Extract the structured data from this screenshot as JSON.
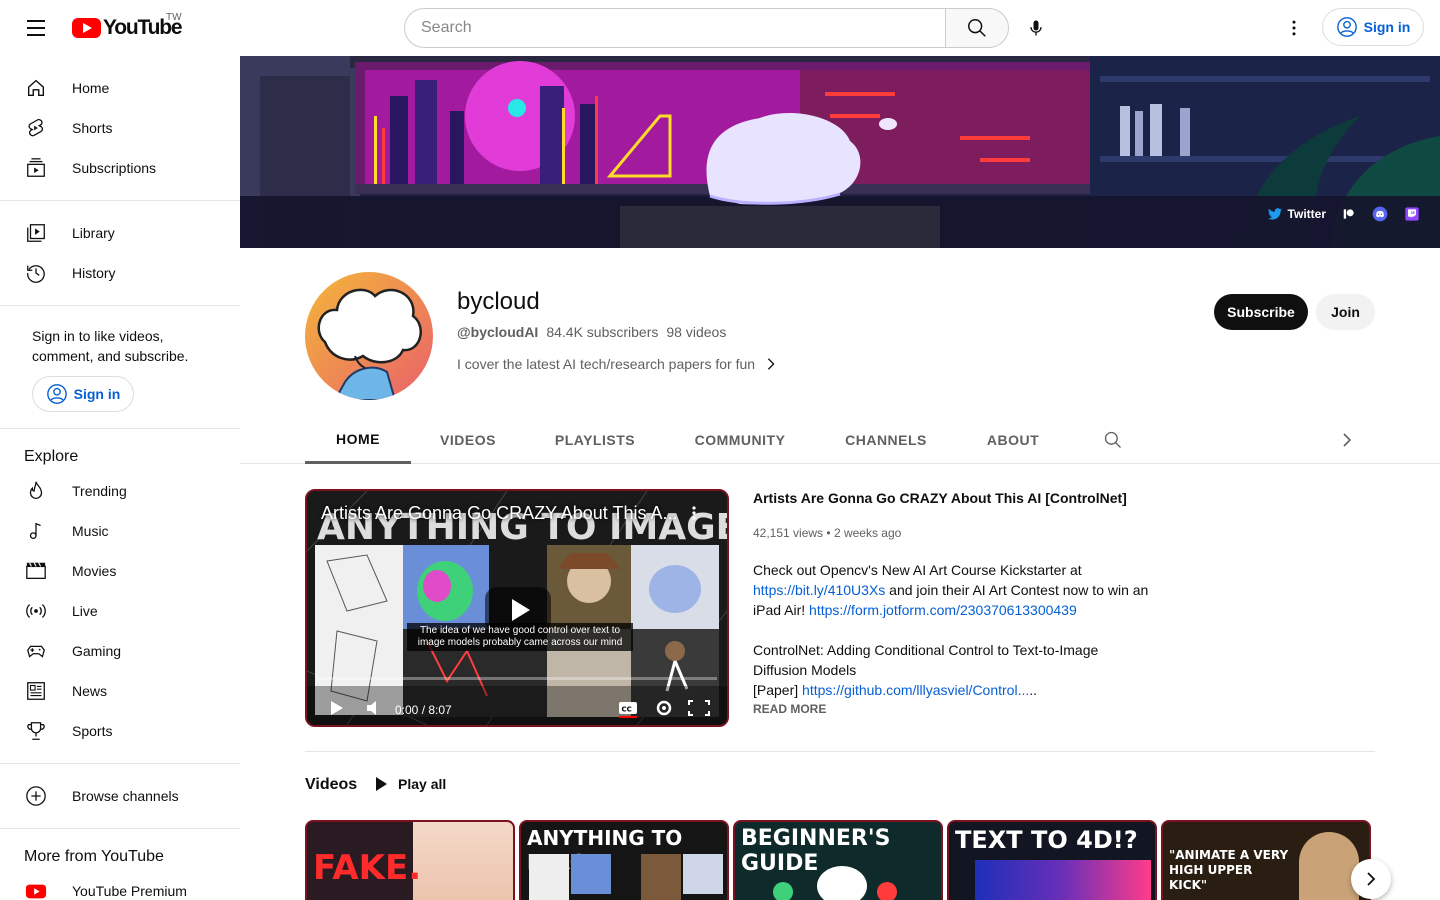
{
  "header": {
    "logo_text": "YouTube",
    "logo_country": "TW",
    "search_placeholder": "Search",
    "signin_label": "Sign in"
  },
  "sidebar": {
    "main": [
      {
        "label": "Home",
        "icon": "home-icon"
      },
      {
        "label": "Shorts",
        "icon": "shorts-icon"
      },
      {
        "label": "Subscriptions",
        "icon": "subscriptions-icon"
      }
    ],
    "you": [
      {
        "label": "Library",
        "icon": "library-icon"
      },
      {
        "label": "History",
        "icon": "history-icon"
      }
    ],
    "signin_prompt": "Sign in to like videos, comment, and subscribe.",
    "signin_label": "Sign in",
    "explore_heading": "Explore",
    "explore": [
      {
        "label": "Trending",
        "icon": "trending-icon"
      },
      {
        "label": "Music",
        "icon": "music-icon"
      },
      {
        "label": "Movies",
        "icon": "movies-icon"
      },
      {
        "label": "Live",
        "icon": "live-icon"
      },
      {
        "label": "Gaming",
        "icon": "gaming-icon"
      },
      {
        "label": "News",
        "icon": "news-icon"
      },
      {
        "label": "Sports",
        "icon": "sports-icon"
      }
    ],
    "browse_channels": "Browse channels",
    "more_heading": "More from YouTube",
    "more": [
      {
        "label": "YouTube Premium",
        "icon": "youtube-premium-icon"
      }
    ]
  },
  "banner": {
    "links": [
      {
        "label": "Twitter",
        "icon": "twitter-icon"
      },
      {
        "label": "",
        "icon": "patreon-icon"
      },
      {
        "label": "",
        "icon": "discord-icon"
      },
      {
        "label": "",
        "icon": "twitch-icon"
      }
    ]
  },
  "channel": {
    "name": "bycloud",
    "handle": "@bycloudAI",
    "subscribers": "84.4K subscribers",
    "videos": "98 videos",
    "description": "I cover the latest AI tech/research papers for fun",
    "subscribe_label": "Subscribe",
    "join_label": "Join"
  },
  "tabs": [
    "HOME",
    "VIDEOS",
    "PLAYLISTS",
    "COMMUNITY",
    "CHANNELS",
    "ABOUT"
  ],
  "featured": {
    "player_title": "Artists Are Gonna Go CRAZY About This A...",
    "player_caption": "The idea of we have good control over text to image models probably came across our mind",
    "player_time": "0:00 / 8:07",
    "title": "Artists Are Gonna Go CRAZY About This AI [ControlNet]",
    "views": "42,151 views",
    "age": "2 weeks ago",
    "desc_line1": "Check out Opencv's New AI Art Course Kickstarter at",
    "link1": "https://bit.ly/410U3Xs",
    "desc_line2": " and join their AI Art Contest now to win an iPad Air! ",
    "link2": "https://form.jotform.com/230370613300439",
    "desc_line3": "ControlNet: Adding Conditional Control to Text-to-Image Diffusion Models",
    "paper_label": "[Paper] ",
    "link3": "https://github.com/lllyasviel/Control...",
    "link3_suffix": "..",
    "read_more": "READ MORE"
  },
  "shelf": {
    "title": "Videos",
    "play_all": "Play all",
    "thumbs": [
      {
        "text": "FAKE.",
        "bg": "#2a1a22"
      },
      {
        "text": "ANYTHING TO IMAGE",
        "bg": "#151515"
      },
      {
        "text": "BEGINNER'S GUIDE",
        "bg": "#0f2a2a"
      },
      {
        "text": "TEXT TO 4D!?",
        "bg": "#111622"
      },
      {
        "text": "\"ANIMATE A VERY HIGH UPPER KICK\"",
        "bg": "#2a1e12"
      }
    ]
  },
  "colors": {
    "brand_red": "#ff0000",
    "link_blue": "#065fd4",
    "text_secondary": "#606060"
  }
}
